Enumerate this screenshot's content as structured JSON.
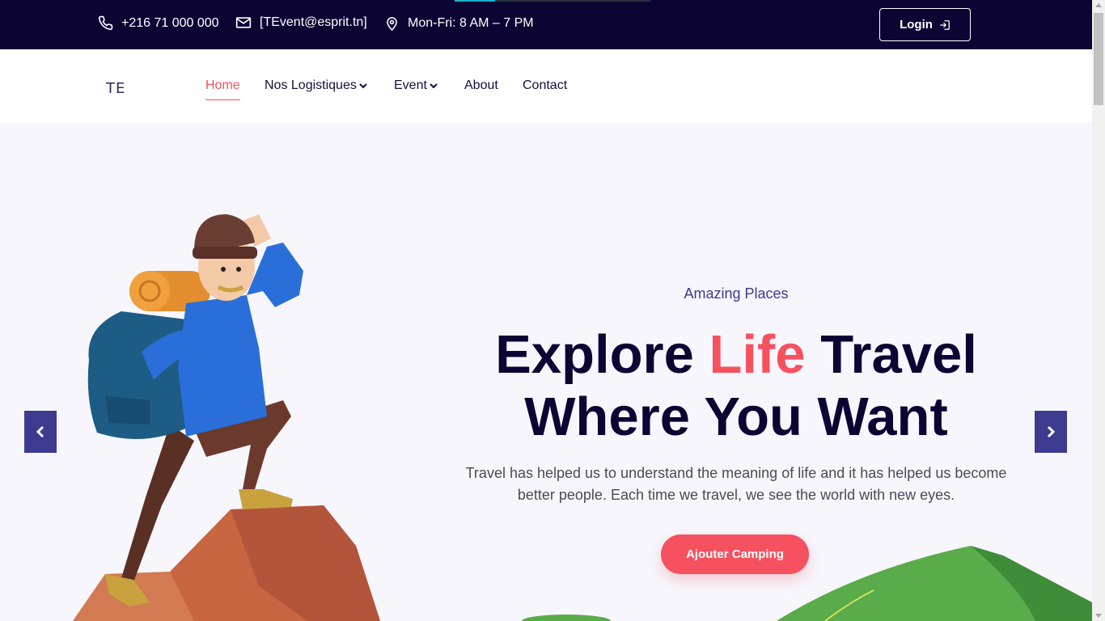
{
  "topbar": {
    "phone": "+216 71 000 000",
    "email": "[TEvent@esprit.tn]",
    "hours": "Mon-Fri: 8 AM – 7 PM",
    "login_label": "Login"
  },
  "nav": {
    "logo": "TE",
    "items": [
      {
        "label": "Home",
        "active": true
      },
      {
        "label": "Nos Logistiques",
        "dropdown": true
      },
      {
        "label": "Event",
        "dropdown": true
      },
      {
        "label": "About"
      },
      {
        "label": "Contact"
      }
    ]
  },
  "hero": {
    "subtitle": "Amazing Places",
    "title_part1": "Explore ",
    "title_highlight": "Life",
    "title_part2": " Travel",
    "title_line2": "Where You Want",
    "text": "Travel has helped us to understand the meaning of life and it has helped us become better people. Each time we travel, we see the world with new eyes.",
    "cta_label": "Ajouter Camping"
  },
  "colors": {
    "navy": "#0c0533",
    "accent": "#f5515f",
    "purple": "#3e3a8f"
  },
  "icons": [
    "phone-icon",
    "mail-icon",
    "location-icon",
    "login-icon",
    "chevron-down-icon",
    "chevron-left-icon",
    "chevron-right-icon"
  ]
}
